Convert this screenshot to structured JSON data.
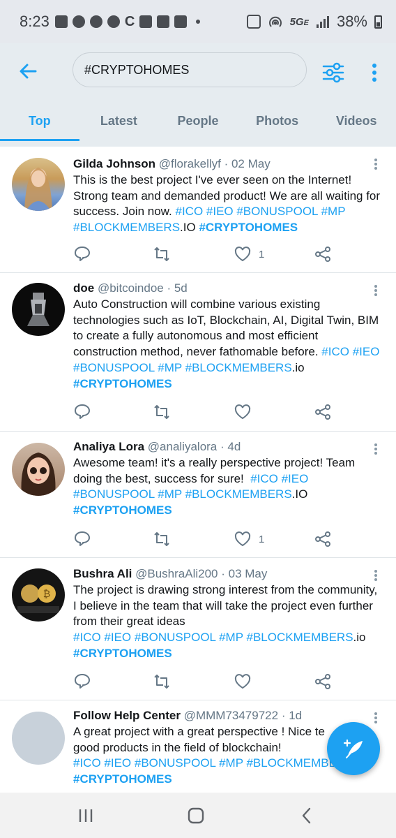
{
  "status_bar": {
    "time": "8:23",
    "network": "5G",
    "battery": "38%",
    "icons": [
      "message-icon",
      "messenger-icon",
      "messenger-icon",
      "messenger-icon",
      "c-icon",
      "bitcoin-icon",
      "brave-icon",
      "brave-icon",
      "dot-icon",
      "nfc-icon",
      "hotspot-icon",
      "signal-icon",
      "battery-icon"
    ]
  },
  "header": {
    "search_value": "#CRYPTOHOMES",
    "tabs": [
      {
        "label": "Top",
        "active": true
      },
      {
        "label": "Latest",
        "active": false
      },
      {
        "label": "People",
        "active": false
      },
      {
        "label": "Photos",
        "active": false
      },
      {
        "label": "Videos",
        "active": false
      }
    ]
  },
  "colors": {
    "accent": "#1da1f2",
    "header_bg": "#e6ecf0",
    "muted": "#657786"
  },
  "tweets": [
    {
      "name": "Gilda Johnson",
      "handle": "@florakellyf",
      "date": "· 02 May",
      "text": "This is the best project I've ever seen on the Internet! Strong team and demanded product! We are all waiting for success. Join now.",
      "tags_line": "#ICO #IEO #BONUSPOOL #MP",
      "tag_members": "#BLOCKMEMBERS",
      "tag_suffix": ".IO",
      "tag_bold": "#CRYPTOHOMES",
      "likes": "1"
    },
    {
      "name": "doe",
      "handle": "@bitcoindoe",
      "date": "· 5d",
      "text": "Auto Construction will combine various existing technologies such as IoT, Blockchain, AI, Digital Twin, BIM to create a fully autonomous and most efficient construction method, never fathomable before.",
      "tag_ico": "#ICO",
      "tags_line": "#IEO #BONUSPOOL #MP",
      "tag_members": "#BLOCKMEMBERS",
      "tag_suffix": ".io",
      "tag_bold": "#CRYPTOHOMES",
      "likes": ""
    },
    {
      "name": "Analiya Lora",
      "handle": "@analiyalora",
      "date": "· 4d",
      "text": "Awesome team! it's a really perspective project! Team doing the best, success for sure!",
      "tags_line": "#ICO #IEO",
      "tags_line2": "#BONUSPOOL #MP",
      "tag_members": "#BLOCKMEMBERS",
      "tag_suffix": ".IO",
      "tag_bold": "#CRYPTOHOMES",
      "likes": "1"
    },
    {
      "name": "Bushra Ali",
      "handle": "@BushraAli200",
      "date": "· 03 May",
      "text": "The project is drawing strong interest from the community, I believe in the team that will take the project even further from their great ideas",
      "tags_line": "#ICO #IEO #BONUSPOOL #MP",
      "tag_members": "#BLOCKMEMBERS",
      "tag_suffix": ".io",
      "tag_bold": "#CRYPTOHOMES",
      "likes": ""
    },
    {
      "name": "Follow Help Center",
      "handle": "@MMM73479722",
      "date": "· 1d",
      "text_line1": "A great project with a great perspective ! Nice te",
      "text_line2": "good products in the field of blockchain!",
      "tags_line": "#ICO #IEO #BONUSPOOL #MP #BLOCKMEMBE",
      "tag_bold": "#CRYPTOHOMES"
    }
  ]
}
